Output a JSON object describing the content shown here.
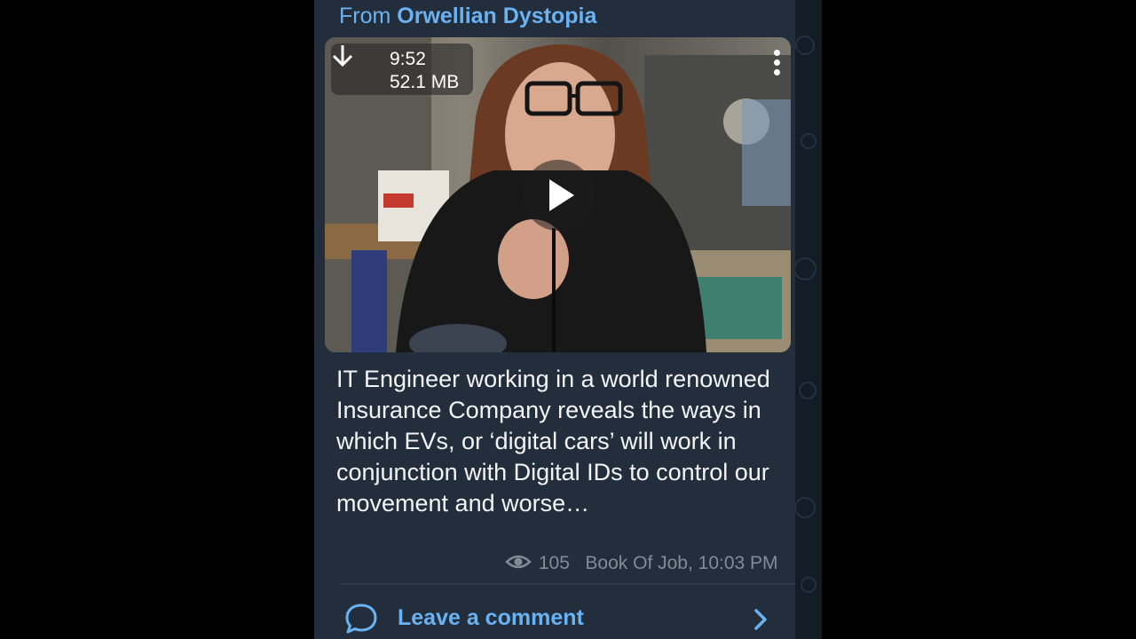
{
  "message": {
    "forwarded_prefix": "From",
    "forwarded_channel": "Orwellian Dystopia",
    "video": {
      "duration": "9:52",
      "file_size": "52.1 MB",
      "download_icon": "download-arrow-icon",
      "more_icon": "vertical-dots-icon",
      "play_icon": "play-icon"
    },
    "caption": "IT Engineer working in a world renowned Insurance Company reveals the ways in which EVs, or ‘digital cars’ will work in conjunction with Digital IDs to control our movement and worse…",
    "views": "105",
    "author_and_time": "Book Of Job, 10:03 PM",
    "views_icon": "eye-icon"
  },
  "comment_bar": {
    "label": "Leave a comment",
    "icon": "comment-bubble-icon",
    "chevron": "chevron-right-icon"
  },
  "colors": {
    "accent": "#6ab2f2",
    "bubble": "#222e3b",
    "background": "#1a2430",
    "meta_text": "#7f8d99"
  }
}
